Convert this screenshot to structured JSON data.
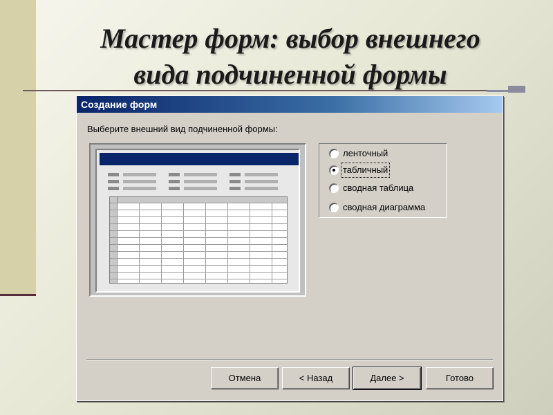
{
  "slide": {
    "title_line1": "Мастер форм: выбор внешнего",
    "title_line2": "вида подчиненной формы"
  },
  "dialog": {
    "title": "Создание форм",
    "prompt": "Выберите внешний вид подчиненной формы:",
    "options": [
      {
        "label": "ленточный",
        "checked": false
      },
      {
        "label": "табличный",
        "checked": true
      },
      {
        "label": "сводная таблица",
        "checked": false
      },
      {
        "label": "сводная диаграмма",
        "checked": false
      }
    ],
    "buttons": {
      "cancel": "Отмена",
      "back": "< Назад",
      "next": "Далее >",
      "finish": "Готово"
    }
  },
  "colors": {
    "titlebar_start": "#0a246a",
    "titlebar_end": "#a6caf0",
    "dialog_bg": "#d4d0c8"
  }
}
